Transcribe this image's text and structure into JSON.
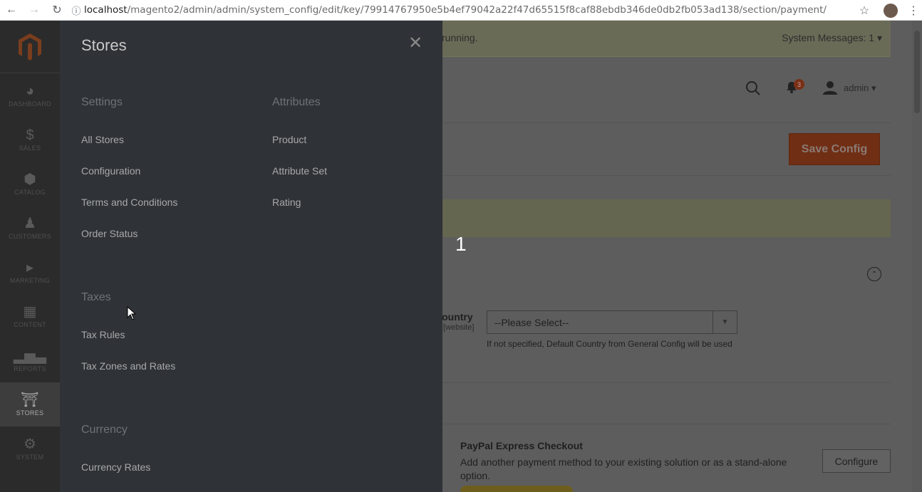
{
  "browser": {
    "url_host": "localhost",
    "url_path": "/magento2/admin/admin/system_config/edit/key/79914767950e5b4ef79042a22f47d65515f8caf88ebdb346de0db2fb053ad138/section/payment/"
  },
  "admin_nav": {
    "items": [
      {
        "label": "DASHBOARD",
        "icon": "speedometer-icon"
      },
      {
        "label": "SALES",
        "icon": "dollar-icon"
      },
      {
        "label": "CATALOG",
        "icon": "cube-icon"
      },
      {
        "label": "CUSTOMERS",
        "icon": "person-icon"
      },
      {
        "label": "MARKETING",
        "icon": "megaphone-icon"
      },
      {
        "label": "CONTENT",
        "icon": "layout-icon"
      },
      {
        "label": "REPORTS",
        "icon": "bar-chart-icon"
      },
      {
        "label": "STORES",
        "icon": "storefront-icon"
      },
      {
        "label": "SYSTEM",
        "icon": "gear-icon"
      }
    ]
  },
  "panel": {
    "title": "Stores",
    "settings": {
      "title": "Settings",
      "links": [
        "All Stores",
        "Configuration",
        "Terms and Conditions",
        "Order Status"
      ]
    },
    "attributes": {
      "title": "Attributes",
      "links": [
        "Product",
        "Attribute Set",
        "Rating"
      ]
    },
    "taxes": {
      "title": "Taxes",
      "links": [
        "Tax Rules",
        "Tax Zones and Rates"
      ]
    },
    "currency": {
      "title": "Currency",
      "links": [
        "Currency Rates"
      ]
    }
  },
  "page": {
    "system_message_fragment": "running.",
    "system_messages": "System Messages: 1",
    "notification_count": "3",
    "user_name": "admin",
    "save_config": "Save Config",
    "step_number": "1",
    "country_label": "Country",
    "country_scope": "[website]",
    "country_select_value": "--Please Select--",
    "country_note": "If not specified, Default Country from General Config will be used",
    "paypal_title": "PayPal Express Checkout",
    "paypal_desc": "Add another payment method to your existing solution or as a stand-alone option.",
    "configure": "Configure"
  }
}
